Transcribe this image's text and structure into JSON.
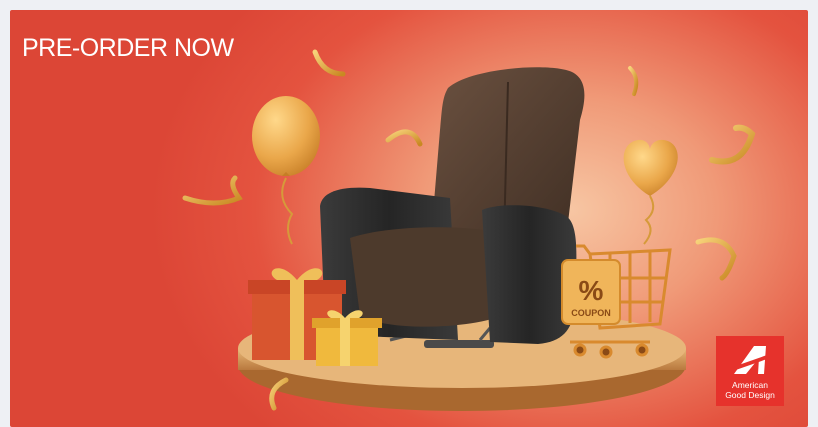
{
  "banner": {
    "headline": "PRE-ORDER NOW",
    "coupon_label": "COUPON",
    "coupon_symbol": "%"
  },
  "brand_badge": {
    "line1": "American",
    "line2": "Good Design",
    "color": "#e6322c"
  },
  "colors": {
    "background": "#dc4636",
    "gold": "#e3a83e",
    "chair_fabric": "#5a4332",
    "chair_leather": "#2d2d2d",
    "gift_red": "#d8552f",
    "platform_wood": "#d79a55"
  }
}
